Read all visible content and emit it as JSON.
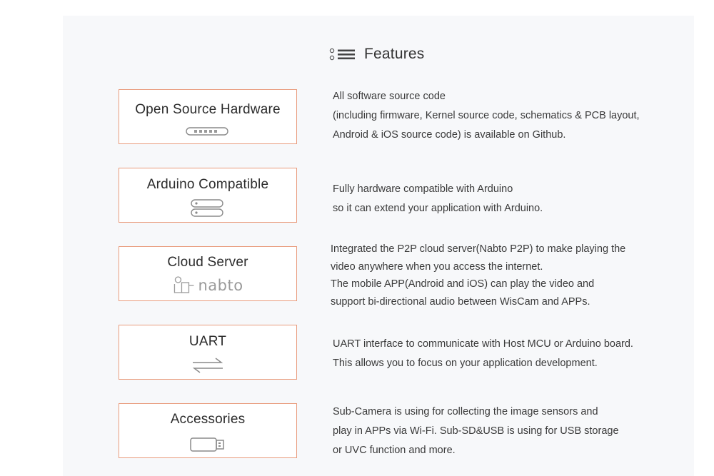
{
  "header": {
    "title": "Features",
    "icon": "list-icon"
  },
  "features": [
    {
      "label": "Open Source Hardware",
      "icon": "board-connector-icon",
      "description": [
        "All software source code",
        "(including firmware, Kernel source code, schematics & PCB layout,",
        "Android & iOS source code) is available on Github."
      ]
    },
    {
      "label": "Arduino Compatible",
      "icon": "stacked-boards-icon",
      "description": [
        "Fully hardware compatible with Arduino",
        "so it can extend your application with Arduino."
      ]
    },
    {
      "label": "Cloud Server",
      "icon": "nabto-logo",
      "logo_text": "nabto",
      "description": [
        "Integrated the P2P cloud server(Nabto P2P) to make playing the",
        "video anywhere when you access the internet.",
        "The mobile APP(Android and iOS) can play the video and",
        "support bi-directional audio between WisCam and APPs."
      ]
    },
    {
      "label": "UART",
      "icon": "transfer-arrows-icon",
      "description": [
        "UART interface to communicate with Host MCU or Arduino board.",
        "This allows you to focus on your application development."
      ]
    },
    {
      "label": "Accessories",
      "icon": "usb-stick-icon",
      "description": [
        "Sub-Camera is using for collecting the image sensors and",
        "play in APPs via Wi-Fi. Sub-SD&USB is using for USB storage",
        "or UVC function and more."
      ]
    }
  ],
  "colors": {
    "card_border": "#e99b7c",
    "panel_bg": "#f7f8fa",
    "icon_gray": "#8a8a8a"
  }
}
